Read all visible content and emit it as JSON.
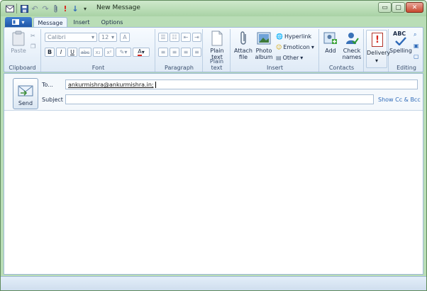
{
  "window": {
    "title": "New Message",
    "colors": {
      "frame": "#b9ddb6",
      "app_menu": "#2c67bb",
      "accent": "#2f6ab8",
      "priority": "#d9261c"
    }
  },
  "quick_access": {
    "icons": [
      "mail-icon",
      "save-icon",
      "undo-icon",
      "redo-icon",
      "attach-icon",
      "high-priority-icon",
      "low-priority-icon",
      "customize-dropdown-icon"
    ]
  },
  "window_controls": {
    "minimize": "▭",
    "maximize": "▢",
    "close": "✕"
  },
  "tabs": [
    {
      "label": "Message",
      "active": true
    },
    {
      "label": "Insert",
      "active": false
    },
    {
      "label": "Options",
      "active": false
    }
  ],
  "ribbon": {
    "clipboard": {
      "label": "Clipboard",
      "paste_label": "Paste"
    },
    "font": {
      "label": "Font",
      "family": "Calibri",
      "size": "12",
      "bold": "B",
      "italic": "I",
      "underline": "U",
      "strike": "abc",
      "subscript": "x₂",
      "superscript": "x²",
      "font_color": "A"
    },
    "paragraph": {
      "label": "Paragraph"
    },
    "plain_text": {
      "label": "Plain text",
      "button_label_1": "Plain",
      "button_label_2": "text"
    },
    "insert": {
      "label": "Insert",
      "attach_1": "Attach",
      "attach_2": "file",
      "photo_1": "Photo",
      "photo_2": "album",
      "hyperlink": "Hyperlink",
      "emoticon": "Emoticon",
      "other": "Other"
    },
    "contacts": {
      "label": "Contacts",
      "add": "Add",
      "check_1": "Check",
      "check_2": "names"
    },
    "delivery": {
      "label": "Delivery"
    },
    "editing": {
      "label": "Editing",
      "spelling": "Spelling",
      "spelling_glyph": "ABC"
    }
  },
  "compose": {
    "send_label": "Send",
    "to_label": "To...",
    "to_value": "ankurmishra@ankurmishra.in;",
    "subject_label": "Subject",
    "subject_value": "",
    "show_cc_bcc": "Show Cc & Bcc"
  }
}
